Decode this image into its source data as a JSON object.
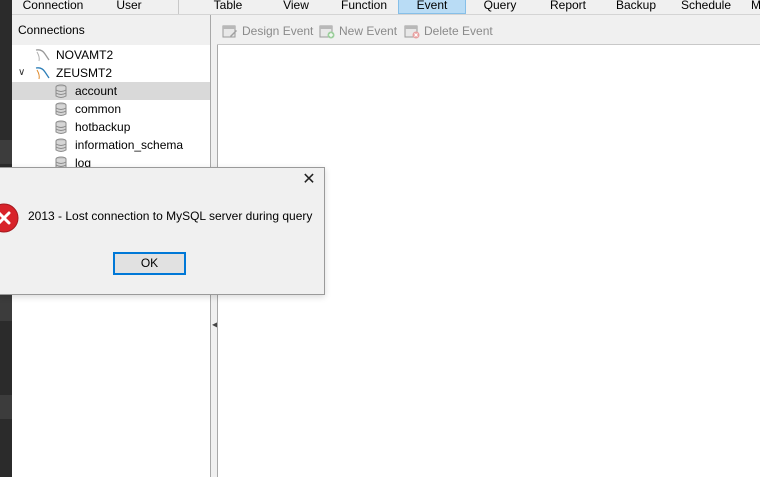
{
  "menubar": {
    "items": [
      {
        "label": "Connection"
      },
      {
        "label": "User"
      },
      {
        "label": "Table"
      },
      {
        "label": "View"
      },
      {
        "label": "Function"
      },
      {
        "label": "Event",
        "active": true
      },
      {
        "label": "Query"
      },
      {
        "label": "Report"
      },
      {
        "label": "Backup"
      },
      {
        "label": "Schedule"
      },
      {
        "label": "M"
      }
    ]
  },
  "connections": {
    "header": "Connections",
    "tree": [
      {
        "label": "NOVAMT2",
        "icon": "mysql-connection-closed-icon",
        "level": 0
      },
      {
        "label": "ZEUSMT2",
        "icon": "mysql-connection-open-icon",
        "level": 0,
        "expanded": true
      },
      {
        "label": "account",
        "icon": "database-icon",
        "level": 1,
        "selected": true
      },
      {
        "label": "common",
        "icon": "database-icon",
        "level": 1
      },
      {
        "label": "hotbackup",
        "icon": "database-icon",
        "level": 1
      },
      {
        "label": "information_schema",
        "icon": "database-icon",
        "level": 1
      },
      {
        "label": "log",
        "icon": "database-icon",
        "level": 1
      }
    ]
  },
  "toolbar": {
    "design_event": "Design Event",
    "new_event": "New Event",
    "delete_event": "Delete Event"
  },
  "dialog": {
    "message": "2013 - Lost connection to MySQL server during query",
    "ok_label": "OK",
    "close_symbol": "✕",
    "icon": "error-icon"
  },
  "colors": {
    "active_menu_bg": "#b9dcf5",
    "error_red": "#d8232a",
    "ok_focus_border": "#0078d7",
    "selected_row": "#d9d9d9"
  }
}
